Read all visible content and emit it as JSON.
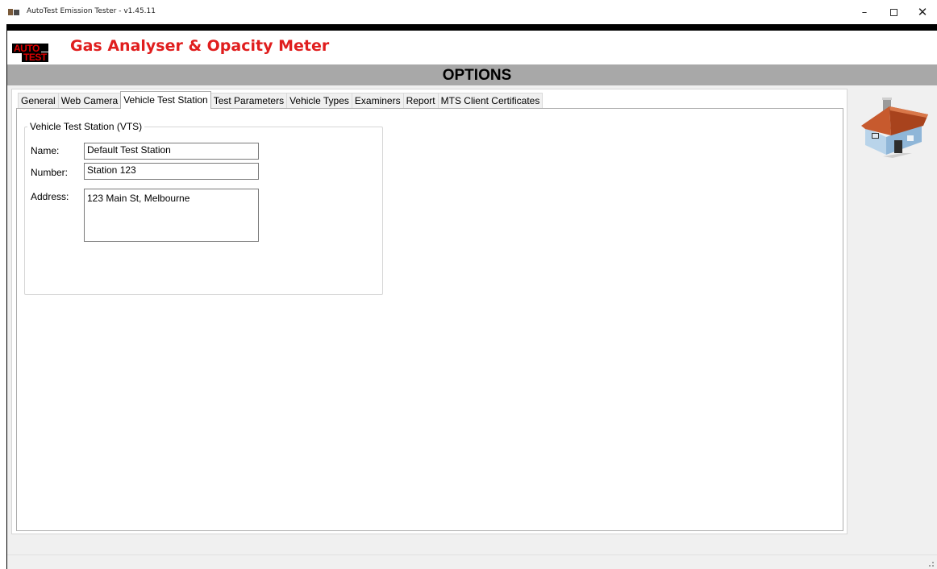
{
  "window": {
    "title": "AutoTest Emission Tester - v1.45.11",
    "controls": {
      "minimize": "–",
      "close": "✕"
    }
  },
  "header": {
    "logo_line1": "AUTO",
    "logo_line2": "TEST",
    "app_title": "Gas Analyser & Opacity Meter",
    "brand_color": "#e01e1e"
  },
  "options_bar": {
    "title": "OPTIONS"
  },
  "tabs": [
    {
      "label": "General",
      "active": false
    },
    {
      "label": "Web Camera",
      "active": false
    },
    {
      "label": "Vehicle Test Station",
      "active": true
    },
    {
      "label": "Test Parameters",
      "active": false
    },
    {
      "label": "Vehicle Types",
      "active": false
    },
    {
      "label": "Examiners",
      "active": false
    },
    {
      "label": "Report",
      "active": false
    },
    {
      "label": "MTS Client Certificates",
      "active": false
    }
  ],
  "vts": {
    "group_title": "Vehicle Test Station (VTS)",
    "name_label": "Name:",
    "name_value": "Default Test Station",
    "number_label": "Number:",
    "number_value": "Station 123",
    "address_label": "Address:",
    "address_value": "123 Main St, Melbourne"
  },
  "icons": {
    "app": "app-icon",
    "home": "home-icon",
    "resize_grip": "resize-grip-icon"
  }
}
